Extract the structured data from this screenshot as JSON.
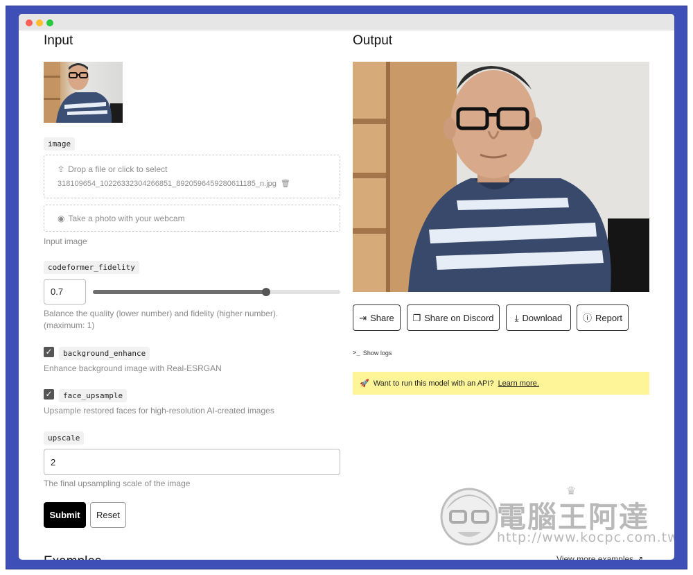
{
  "input_panel": {
    "heading": "Input",
    "image_field": {
      "tag": "image",
      "drop_label": "Drop a file or click to select",
      "file_name": "318109654_10226332304266851_8920596459280611185_n.jpg",
      "webcam_label": "Take a photo with your webcam",
      "description": "Input image"
    },
    "fidelity_field": {
      "tag": "codeformer_fidelity",
      "value": "0.7",
      "slider_value": 0.7,
      "description": "Balance the quality (lower number) and fidelity (higher number). (maximum: 1)"
    },
    "background_field": {
      "tag": "background_enhance",
      "checked": true,
      "description": "Enhance background image with Real-ESRGAN"
    },
    "face_field": {
      "tag": "face_upsample",
      "checked": true,
      "description": "Upsample restored faces for high-resolution AI-created images"
    },
    "upscale_field": {
      "tag": "upscale",
      "value": "2",
      "description": "The final upsampling scale of the image"
    },
    "submit_label": "Submit",
    "reset_label": "Reset",
    "examples_heading": "Examples"
  },
  "output_panel": {
    "heading": "Output",
    "buttons": {
      "share": "Share",
      "discord": "Share on Discord",
      "download": "Download",
      "report": "Report"
    },
    "show_logs": "Show logs",
    "api_banner": {
      "text": "Want to run this model with an API?",
      "link": "Learn more."
    },
    "view_more": "View more examples"
  },
  "watermark": {
    "chinese": "電腦王阿達",
    "url": "http://www.kocpc.com.tw"
  },
  "icons": {
    "upload": "upload-icon",
    "trash": "trash-icon",
    "camera": "camera-icon",
    "share": "share-icon",
    "copy": "copy-icon",
    "download": "download-icon",
    "report": "alert-circle-icon",
    "terminal": "terminal-icon",
    "rocket": "rocket-icon"
  },
  "colors": {
    "frame": "#3f4fb8",
    "banner": "#fef599",
    "primary_button": "#000000"
  }
}
